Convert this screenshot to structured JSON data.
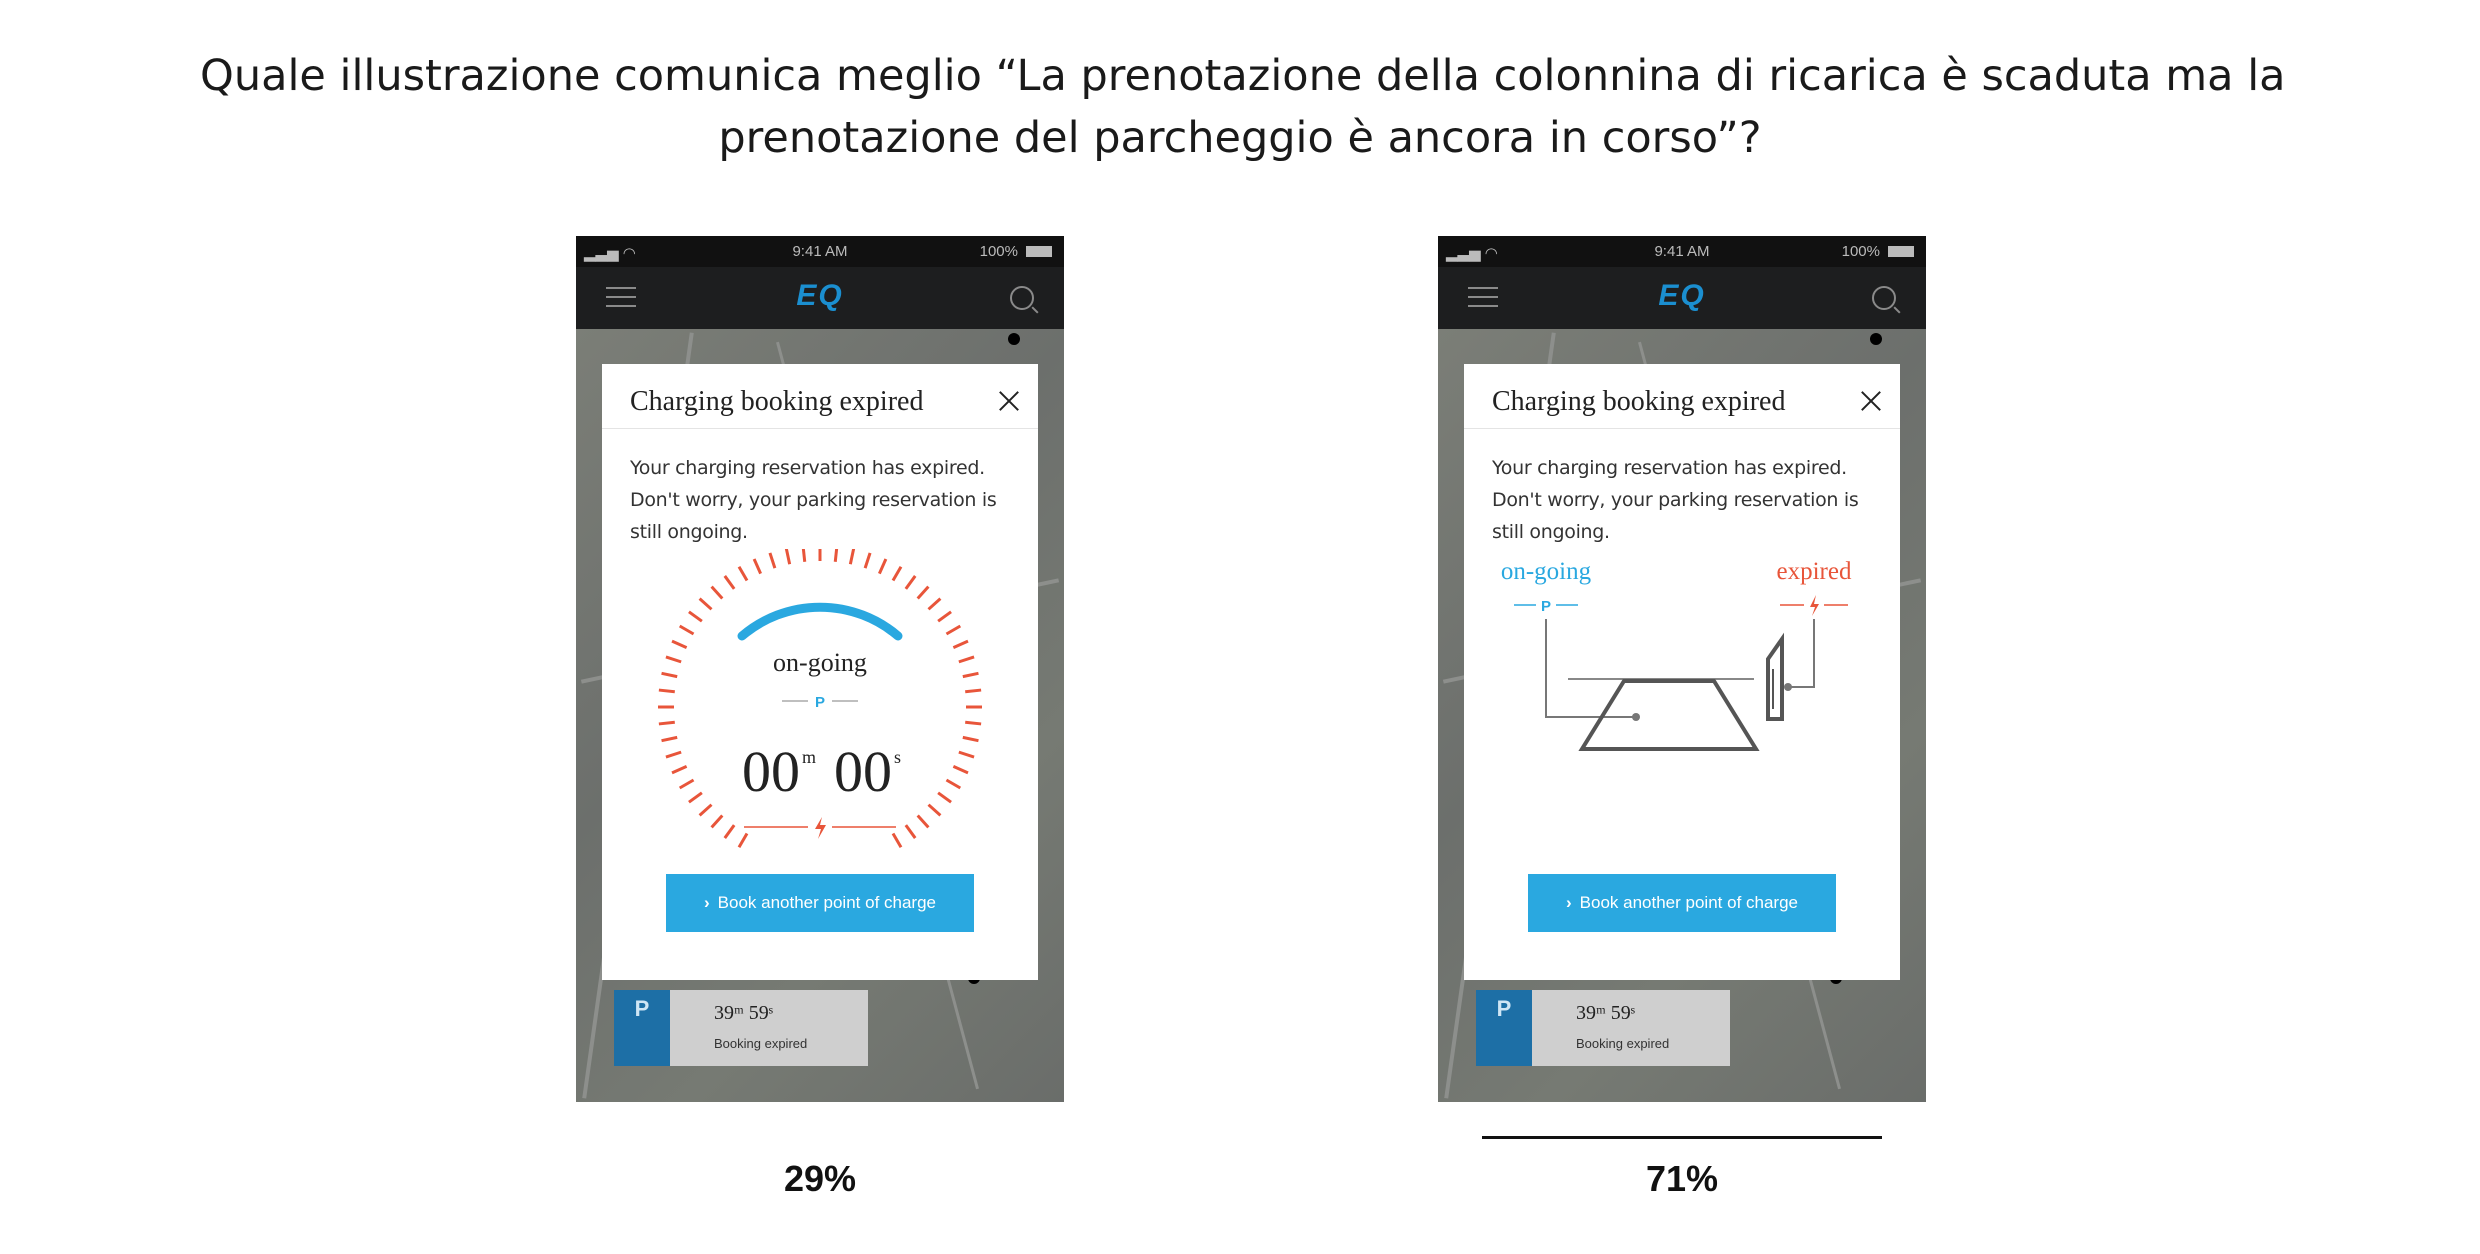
{
  "question": {
    "line1": "Quale illustrazione comunica meglio “La prenotazione della colonnina di ricarica è scaduta ma la",
    "line2": "prenotazione del parcheggio è ancora in corso”?"
  },
  "options": [
    {
      "status_time": "9:41 AM",
      "battery": "100%",
      "logo": "EQ",
      "modal_title": "Charging booking expired",
      "message_lines": [
        "Your charging reservation has expired.",
        "Don't worry, your parking reservation is",
        "still ongoing."
      ],
      "gauge_label": "on-going",
      "gauge_p": "P",
      "timer_min": "00",
      "timer_min_unit": "m",
      "timer_sec": "00",
      "timer_sec_unit": "s",
      "button_label": "Book another point of charge",
      "card_time": "39ᵐ 59ˢ",
      "card_label": "Booking expired",
      "card_badge": "P",
      "result": "29%"
    },
    {
      "status_time": "9:41 AM",
      "battery": "100%",
      "logo": "EQ",
      "modal_title": "Charging booking expired",
      "message_lines": [
        "Your charging reservation has expired.",
        "Don't worry, your parking reservation is",
        "still ongoing."
      ],
      "ongoing_label": "on-going",
      "ongoing_p": "P",
      "expired_label": "expired",
      "button_label": "Book another point of charge",
      "card_time": "39ᵐ 59ˢ",
      "card_label": "Booking expired",
      "card_badge": "P",
      "result": "71%"
    }
  ],
  "colors": {
    "accent_blue": "#2aa8e0",
    "expired_orange": "#e8553a",
    "winner_underline": "#111111"
  }
}
